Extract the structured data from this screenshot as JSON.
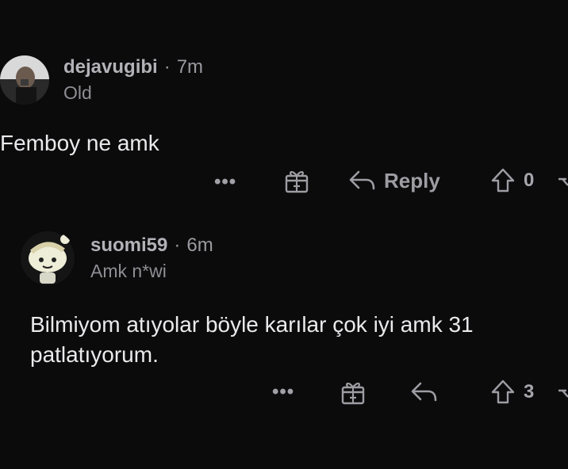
{
  "comments": [
    {
      "username": "dejavugibi",
      "separator": "·",
      "time": "7m",
      "flair": "Old",
      "body": [
        "Femboy ne amk"
      ],
      "actions": {
        "more_label": "•••",
        "reply_label": "Reply",
        "vote_count": "0"
      }
    },
    {
      "username": "suomi59",
      "separator": "·",
      "time": "6m",
      "flair": "Amk n*wi",
      "body": [
        "Bilmiyom atıyolar böyle karılar çok iyi amk 31",
        "patlatıyorum."
      ],
      "actions": {
        "more_label": "•••",
        "reply_label": "",
        "vote_count": "3"
      }
    }
  ],
  "icons": {
    "avatar_1": "user-photo-avatar",
    "avatar_2": "cartoon-avatar",
    "award": "gift-award-icon",
    "reply": "reply-arrow-icon",
    "upvote": "upvote-arrow-icon",
    "downvote": "downvote-arrow-icon"
  },
  "colors": {
    "background": "#0b0b0c",
    "text": "#eaeaec",
    "muted": "#9d9da3"
  }
}
